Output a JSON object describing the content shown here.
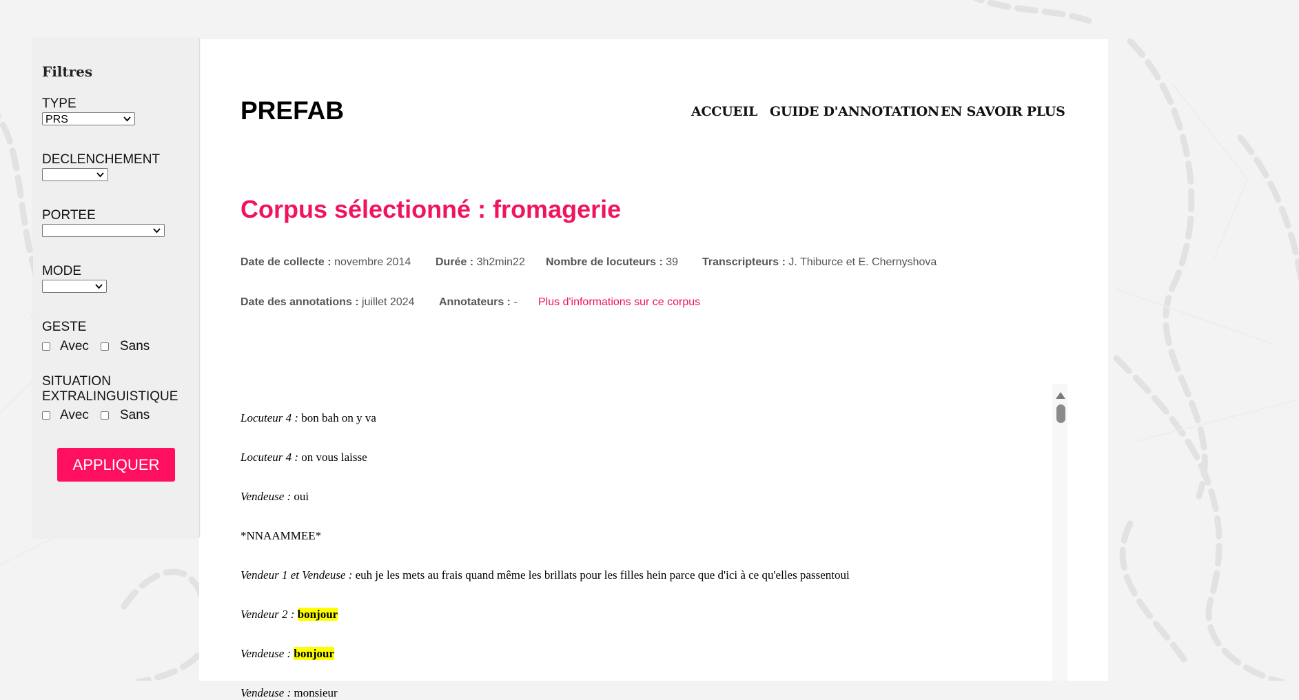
{
  "sidebar": {
    "heading": "Filtres",
    "type_label": "TYPE",
    "type_value": "PRS",
    "declenchement_label": "DECLENCHEMENT",
    "declenchement_value": "",
    "portee_label": "PORTEE",
    "portee_value": "",
    "mode_label": "MODE",
    "mode_value": "",
    "geste_label": "GESTE",
    "situation_label_1": "SITUATION",
    "situation_label_2": "EXTRALINGUISTIQUE",
    "avec_label": "Avec",
    "sans_label": "Sans",
    "apply_label": "APPLIQUER"
  },
  "header": {
    "logo": "PREFAB",
    "nav": [
      "ACCUEIL",
      "GUIDE D'ANNOTATION",
      "EN SAVOIR PLUS"
    ]
  },
  "corpus": {
    "title": "Corpus sélectionné : fromagerie",
    "date_collecte_label": "Date de collecte :",
    "date_collecte": "novembre 2014",
    "duree_label": "Durée :",
    "duree": "3h2min22",
    "locuteurs_label": "Nombre de locuteurs :",
    "locuteurs": "39",
    "transcripteurs_label": "Transcripteurs :",
    "transcripteurs": "J. Thiburce et E. Chernyshova",
    "date_annot_label": "Date des annotations :",
    "date_annot": "juillet 2024",
    "annotateurs_label": "Annotateurs :",
    "annotateurs": "-",
    "more_link": "Plus d'informations sur ce corpus"
  },
  "transcript": [
    {
      "speaker": "Locuteur 4 :",
      "text": "bon bah on y va",
      "highlight": ""
    },
    {
      "speaker": "Locuteur 4 :",
      "text": "on vous laisse",
      "highlight": ""
    },
    {
      "speaker": "Vendeuse :",
      "text": "oui",
      "highlight": ""
    },
    {
      "speaker": "",
      "text": "*NNAAMMEE*",
      "highlight": ""
    },
    {
      "speaker": "Vendeur 1 et Vendeuse :",
      "text": "euh je les mets au frais quand même les brillats pour les filles hein parce que d'ici à ce qu'elles passentoui",
      "highlight": ""
    },
    {
      "speaker": "Vendeur 2 :",
      "text": "",
      "highlight": "bonjour"
    },
    {
      "speaker": "Vendeuse :",
      "text": "",
      "highlight": "bonjour"
    },
    {
      "speaker": "Vendeuse :",
      "text": "monsieur",
      "highlight": ""
    }
  ]
}
